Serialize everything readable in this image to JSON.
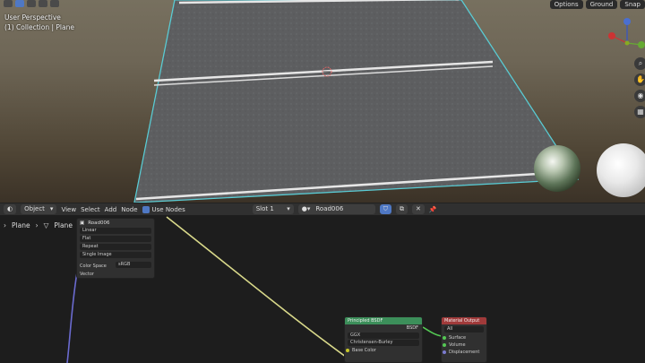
{
  "viewport": {
    "view_name": "User Perspective",
    "collection_label": "(1) Collection | Plane",
    "header_right": {
      "options_label": "Options",
      "ground_label": "Ground",
      "snap_label": "Snap"
    }
  },
  "node_header": {
    "editor_type_icon": "node-editor-icon",
    "mode": "Object",
    "menus": [
      "View",
      "Select",
      "Add",
      "Node"
    ],
    "use_nodes_label": "Use Nodes",
    "slot": "Slot 1",
    "material_name": "Road006"
  },
  "breadcrumb": {
    "object": "Plane",
    "mesh": "Plane",
    "material": "Road006"
  },
  "image_node": {
    "fields": [
      "Linear",
      "Flat",
      "Repeat",
      "Single Image"
    ],
    "color_space_label": "Color Space",
    "color_space_value": "sRGB",
    "vector_label": "Vector"
  },
  "bsdf_node": {
    "title": "Principled BSDF",
    "output": "BSDF",
    "distribution": "GGX",
    "subsurface": "Christensen-Burley",
    "base_color_label": "Base Color",
    "header_color": "#3c8f5a"
  },
  "output_node": {
    "title": "Material Output",
    "target": "All",
    "sockets": [
      "Surface",
      "Volume",
      "Displacement"
    ],
    "header_color": "#a03a3a"
  },
  "colors": {
    "accent": "#4f78c4",
    "selection_outline": "#5fd7e0",
    "wire_yellow": "#d9d98a",
    "wire_blue": "#6b6bd0"
  }
}
